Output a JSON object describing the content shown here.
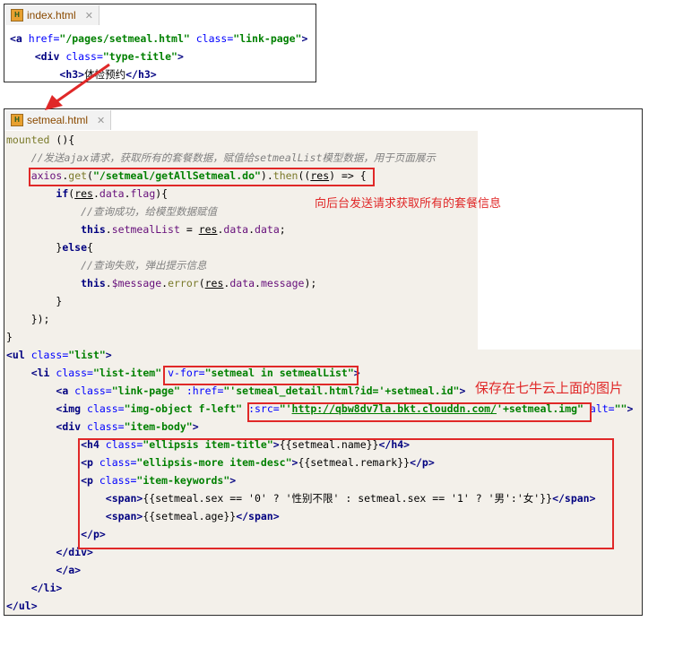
{
  "editor1": {
    "tab_label": "index.html",
    "lines": [
      "<a href=\"/pages/setmeal.html\" class=\"link-page\">",
      "    <div class=\"type-title\">",
      "        <h3>体检预约</h3>"
    ]
  },
  "editor2": {
    "tab_label": "setmeal.html",
    "lines": [
      "mounted (){",
      "    //发送ajax请求，获取所有的套餐数据，赋值给setmealList模型数据，用于页面展示",
      "    axios.get(\"/setmeal/getAllSetmeal.do\").then((res) => {",
      "        if(res.data.flag){",
      "            //查询成功，给模型数据赋值",
      "            this.setmealList = res.data.data;",
      "        }else{",
      "            //查询失败，弹出提示信息",
      "            this.$message.error(res.data.message);",
      "        }",
      "    });",
      "}",
      "<ul class=\"list\">",
      "    <li class=\"list-item\" v-for=\"setmeal in setmealList\">",
      "        <a class=\"link-page\" :href=\"'setmeal_detail.html?id='+setmeal.id\">",
      "        <img class=\"img-object f-left\" :src=\"'http://qbw8dv7la.bkt.clouddn.com/'+setmeal.img\" alt=\"\">",
      "        <div class=\"item-body\">",
      "            <h4 class=\"ellipsis item-title\">{{setmeal.name}}</h4>",
      "            <p class=\"ellipsis-more item-desc\">{{setmeal.remark}}</p>",
      "            <p class=\"item-keywords\">",
      "                <span>{{setmeal.sex == '0' ? '性别不限' : setmeal.sex == '1' ? '男':'女'}}</span>",
      "                <span>{{setmeal.age}}</span>",
      "            </p>",
      "        </div>",
      "        </a>",
      "    </li>",
      "</ul>"
    ]
  },
  "annotations": {
    "request_note": "向后台发送请求获取所有的套餐信息",
    "image_note": "保存在七牛云上面的图片"
  },
  "colors": {
    "highlight": "#e02828",
    "arrow": "#e02828"
  }
}
